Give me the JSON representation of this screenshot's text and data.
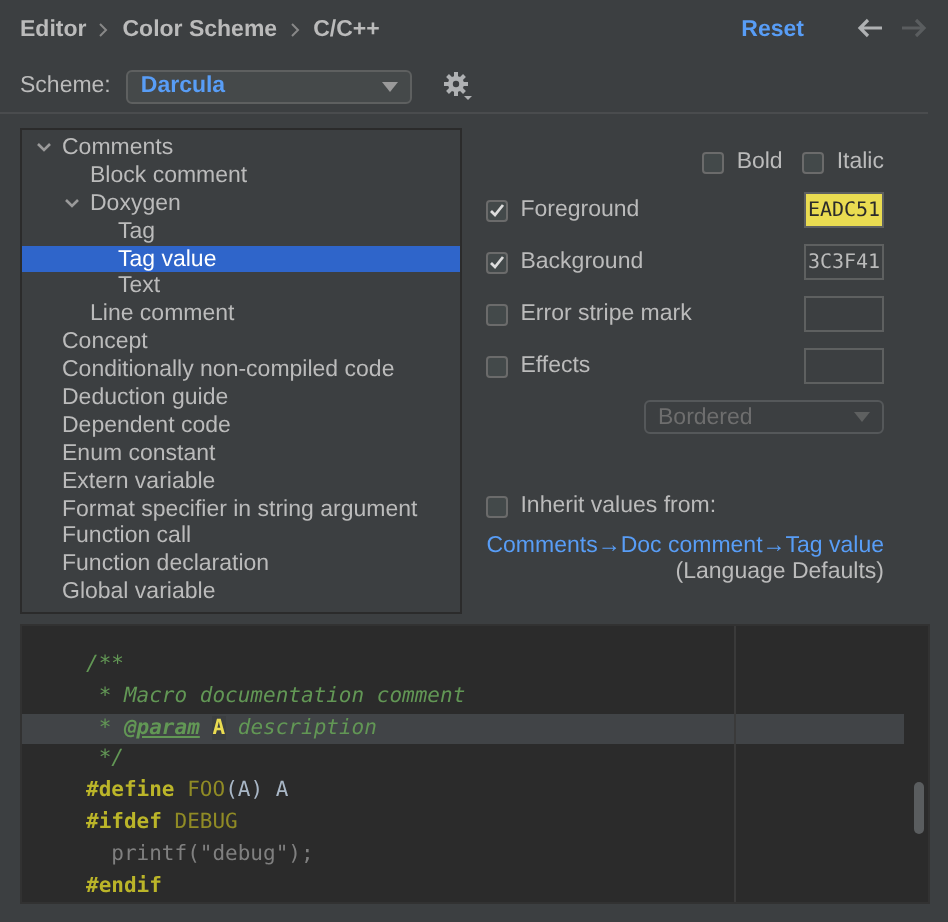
{
  "breadcrumb": [
    {
      "label": "Editor"
    },
    {
      "label": "Color Scheme"
    },
    {
      "label": "C/C++"
    }
  ],
  "reset_link": "Reset",
  "nav": [
    {
      "kind": "back",
      "disabled": false
    },
    {
      "kind": "forward",
      "disabled": true
    }
  ],
  "scheme": {
    "label": "Scheme:",
    "value": "Darcula"
  },
  "tree": [
    {
      "label": "Comments",
      "expanded": true,
      "selected": false,
      "children": [
        {
          "label": "Block comment",
          "selected": false
        },
        {
          "label": "Doxygen",
          "expanded": true,
          "selected": false,
          "children": [
            {
              "label": "Tag",
              "selected": false
            },
            {
              "label": "Tag value",
              "selected": true
            },
            {
              "label": "Text",
              "selected": false
            }
          ]
        },
        {
          "label": "Line comment",
          "selected": false
        }
      ]
    },
    {
      "label": "Concept",
      "selected": false
    },
    {
      "label": "Conditionally non-compiled code",
      "selected": false
    },
    {
      "label": "Deduction guide",
      "selected": false
    },
    {
      "label": "Dependent code",
      "selected": false
    },
    {
      "label": "Enum constant",
      "selected": false
    },
    {
      "label": "Extern variable",
      "selected": false
    },
    {
      "label": "Format specifier in string argument",
      "selected": false
    },
    {
      "label": "Function call",
      "selected": false
    },
    {
      "label": "Function declaration",
      "selected": false
    },
    {
      "label": "Global variable",
      "selected": false
    }
  ],
  "font_style": [
    {
      "label": "Bold",
      "checked": false
    },
    {
      "label": "Italic",
      "checked": false
    }
  ],
  "attributes": [
    {
      "label": "Foreground",
      "checked": true,
      "value": "EADC51",
      "color": "#eadc51"
    },
    {
      "label": "Background",
      "checked": true,
      "value": "3C3F41",
      "color": "#3c3f41"
    },
    {
      "label": "Error stripe mark",
      "checked": false
    },
    {
      "label": "Effects",
      "checked": false
    }
  ],
  "effect_type": {
    "value": "Bordered",
    "disabled": true
  },
  "inherit": {
    "label": "Inherit values from:",
    "checked": false,
    "link": "Comments→Doc comment→Tag value",
    "note": "(Language Defaults)"
  },
  "preview": {
    "lines": [
      {
        "current": false,
        "tokens": [
          {
            "kind": "comment",
            "text": "/**"
          }
        ]
      },
      {
        "current": false,
        "tokens": [
          {
            "kind": "comment",
            "text": " * Macro documentation comment"
          }
        ]
      },
      {
        "current": true,
        "tokens": [
          {
            "kind": "comment",
            "text": " * "
          },
          {
            "kind": "doctag",
            "text": "@param"
          },
          {
            "kind": "tagvalue",
            "text": "A",
            "space_before": true
          },
          {
            "kind": "comment",
            "text": " description"
          }
        ]
      },
      {
        "current": false,
        "tokens": [
          {
            "kind": "comment",
            "text": " */"
          }
        ]
      },
      {
        "current": false,
        "tokens": [
          {
            "kind": "directive",
            "text": "#define"
          },
          {
            "kind": "macro",
            "text": "FOO",
            "space_before": true
          },
          {
            "kind": "plain",
            "text": "(A) A"
          }
        ]
      },
      {
        "current": false,
        "tokens": [
          {
            "kind": "directive",
            "text": "#ifdef"
          },
          {
            "kind": "macro",
            "text": "DEBUG",
            "space_before": true
          }
        ]
      },
      {
        "current": false,
        "tokens": [
          {
            "kind": "inactive",
            "text": "  printf(\"debug\");"
          }
        ]
      },
      {
        "current": false,
        "tokens": [
          {
            "kind": "directive",
            "text": "#endif"
          }
        ]
      }
    ]
  }
}
